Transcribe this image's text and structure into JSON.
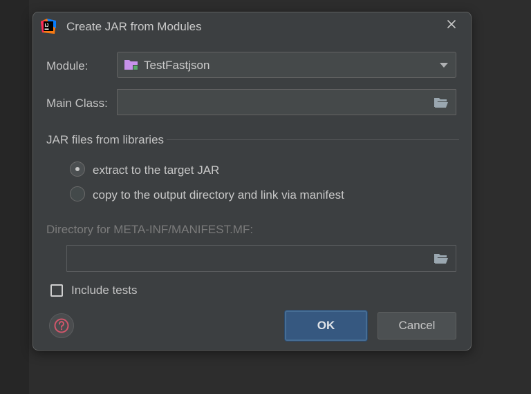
{
  "window": {
    "title": "Create JAR from Modules"
  },
  "module": {
    "label": "Module:",
    "value": "TestFastjson"
  },
  "main_class": {
    "label": "Main Class:",
    "value": ""
  },
  "libraries": {
    "section_title": "JAR files from libraries",
    "options": [
      {
        "label": "extract to the target JAR",
        "selected": true
      },
      {
        "label": "copy to the output directory and link via manifest",
        "selected": false
      }
    ]
  },
  "manifest_dir": {
    "label": "Directory for META-INF/MANIFEST.MF:",
    "value": "",
    "enabled": false
  },
  "include_tests": {
    "label": "Include tests",
    "checked": false
  },
  "buttons": {
    "ok": "OK",
    "cancel": "Cancel"
  },
  "icons": {
    "app": "intellij-idea-icon",
    "close": "close-icon",
    "module": "module-folder-icon",
    "browse": "open-folder-icon",
    "help": "help-icon",
    "dropdown": "chevron-down-icon"
  },
  "colors": {
    "accent": "#365880",
    "help": "#d2566b",
    "module_folder": "#c792ea"
  }
}
